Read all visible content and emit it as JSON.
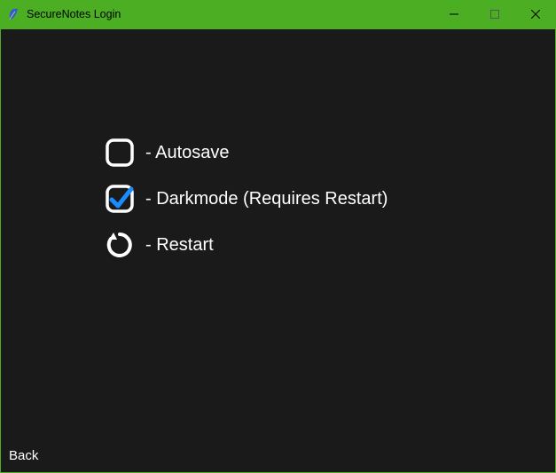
{
  "titlebar": {
    "title": "SecureNotes Login"
  },
  "settings": {
    "autosave": {
      "label": "- Autosave",
      "checked": false
    },
    "darkmode": {
      "label": "- Darkmode (Requires Restart)",
      "checked": true
    },
    "restart": {
      "label": "- Restart"
    }
  },
  "footer": {
    "back_label": "Back"
  },
  "colors": {
    "accent": "#4caf23",
    "background": "#1a1a1a",
    "check": "#1a8cff"
  }
}
